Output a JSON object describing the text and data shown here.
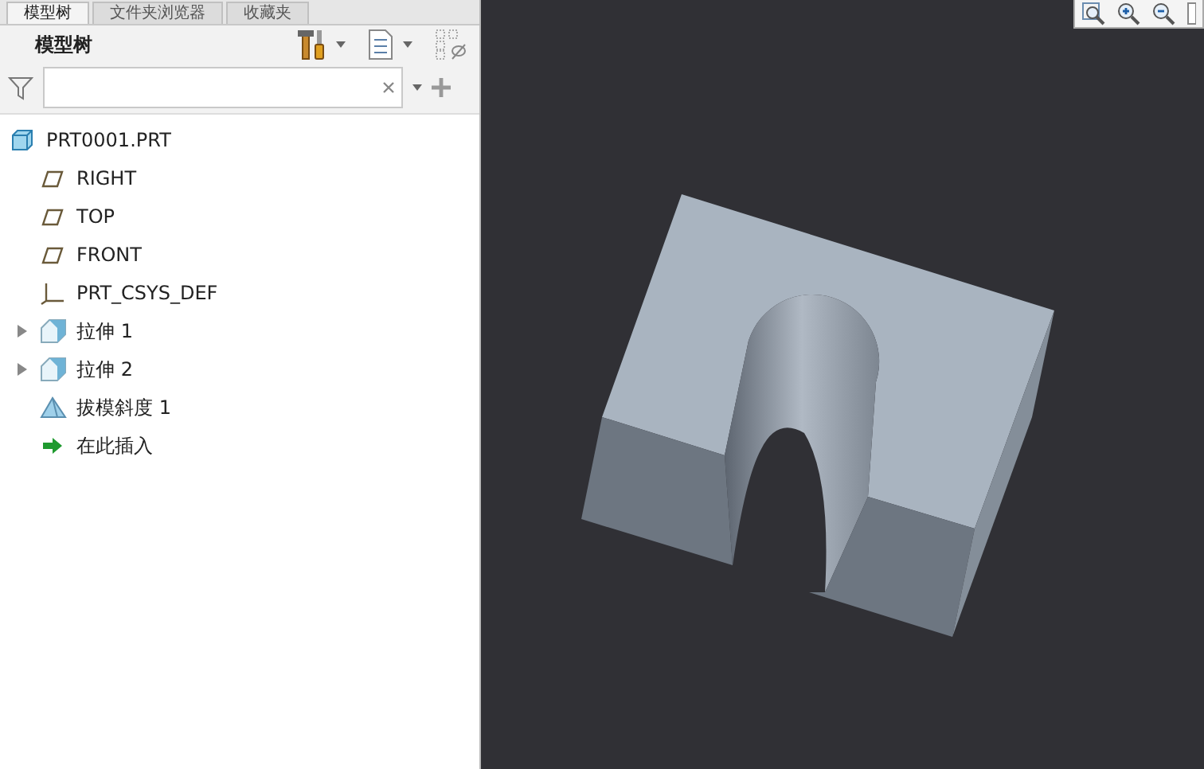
{
  "tabs": [
    {
      "label": "模型树",
      "selected": true
    },
    {
      "label": "文件夹浏览器",
      "selected": false
    },
    {
      "label": "收藏夹",
      "selected": false
    }
  ],
  "panel": {
    "title": "模型树"
  },
  "tree": [
    {
      "label": "PRT0001.PRT",
      "kind": "part"
    },
    {
      "label": "RIGHT",
      "kind": "plane"
    },
    {
      "label": "TOP",
      "kind": "plane"
    },
    {
      "label": "FRONT",
      "kind": "plane"
    },
    {
      "label": "PRT_CSYS_DEF",
      "kind": "csys"
    },
    {
      "label": "拉伸 1",
      "kind": "extrude",
      "expanded": false
    },
    {
      "label": "拉伸 2",
      "kind": "extrude",
      "expanded": false
    },
    {
      "label": "拔模斜度 1",
      "kind": "draft"
    },
    {
      "label": "在此插入",
      "kind": "insert"
    }
  ]
}
